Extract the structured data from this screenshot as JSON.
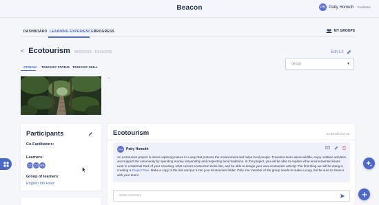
{
  "header": {
    "brand": "Beacon",
    "user_initials": "PH",
    "user_name": "Patty Homuth",
    "user_role": "Facilitator"
  },
  "nav": {
    "items": [
      "DASHBOARD",
      "LEARNING EXPERIENCES",
      "PROGRESS"
    ],
    "active": "LEARNING EXPERIENCES",
    "my_groups": "MY GROUPS"
  },
  "experience": {
    "back": "<",
    "title": "Ecotourism",
    "dates": "09/02/2023 - 10/31/2025",
    "edit_label": "Edit LX"
  },
  "subtabs": {
    "items": [
      "STREAM",
      "TASKS BY STATUS",
      "TASKS BY SKILL"
    ],
    "active": "STREAM"
  },
  "group_select": {
    "placeholder": "Group"
  },
  "media_caption": "-",
  "participants": {
    "title": "Participants",
    "co_facilitators_label": "Co-Facilitators:",
    "learners_label": "Learners:",
    "learner_initials": [
      "CC",
      "CC",
      "RB"
    ],
    "group_label": "Group of learners:",
    "group_value": "English 6th Hour"
  },
  "post": {
    "title": "Ecotourism",
    "time": "11:26 am Oct 22",
    "author_initials": "PH",
    "author": "Patty Homuth",
    "body_before_link": "An ecotourism project is about exploring nature in a way that protects the environment and helps local people. Travelers learn about wildlife, enjoy outdoor activities, and support the community by spending money responsibly and respecting local traditions. In this project, you will be able to explore what environmental issues exist in a National Park of your choosing, what current ecotourism looks like, and be able to design your own ecotourism activity! The first thing we will be doing is creating a",
    "link_text": "Project Plan",
    "body_after_link": ". Make a copy of the link and put it into your Ecotourism folder. Only one member of the group needs to make a copy, but be sure to share it with your team!"
  },
  "comment": {
    "placeholder": "Write comment"
  },
  "colors": {
    "accent": "#4a68c7",
    "avatar": "#5b6fd1",
    "background": "#f5f6fa",
    "post_background": "#eef0fa"
  }
}
